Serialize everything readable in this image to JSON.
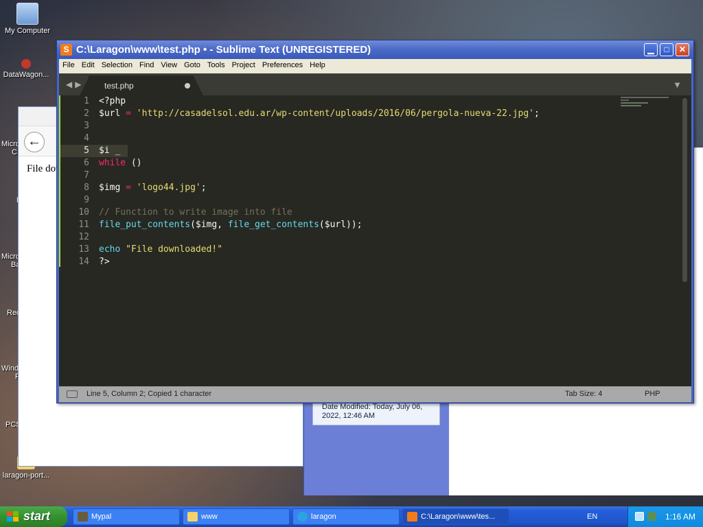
{
  "desktop": {
    "icons": [
      {
        "label": "My Computer"
      },
      {
        "label": "DataWagon..."
      },
      {
        "label": "laragon-port..."
      }
    ],
    "partial_labels": [
      "Micro",
      "C",
      "N",
      "Micro",
      "Ba",
      "Rec",
      "Windo",
      "F",
      "PCS"
    ]
  },
  "bg_browser": {
    "content_text": "File dov"
  },
  "bg_explorer": {
    "details_text": "Date Modified: Today, July 06, 2022, 12:46 AM"
  },
  "sublime": {
    "title": "C:\\Laragon\\www\\test.php • - Sublime Text (UNREGISTERED)",
    "menu": [
      "File",
      "Edit",
      "Selection",
      "Find",
      "View",
      "Goto",
      "Tools",
      "Project",
      "Preferences",
      "Help"
    ],
    "tab": {
      "label": "test.php"
    },
    "active_line": 5,
    "code_lines": [
      {
        "n": "1",
        "tokens": [
          {
            "t": "<?php",
            "c": ""
          }
        ]
      },
      {
        "n": "2",
        "tokens": [
          {
            "t": "$url",
            "c": ""
          },
          {
            "t": " = ",
            "c": "op"
          },
          {
            "t": "'http://casadelsol.edu.ar/wp-content/uploads/2016/06/pergola-nueva-22.jpg'",
            "c": "str"
          },
          {
            "t": ";",
            "c": ""
          }
        ]
      },
      {
        "n": "3",
        "tokens": []
      },
      {
        "n": "4",
        "tokens": []
      },
      {
        "n": "5",
        "tokens": [
          {
            "t": "$i _",
            "c": ""
          }
        ]
      },
      {
        "n": "6",
        "tokens": [
          {
            "t": "while",
            "c": "kw"
          },
          {
            "t": " ()",
            "c": ""
          }
        ]
      },
      {
        "n": "7",
        "tokens": []
      },
      {
        "n": "8",
        "tokens": [
          {
            "t": "$img",
            "c": ""
          },
          {
            "t": " = ",
            "c": "op"
          },
          {
            "t": "'logo44.jpg'",
            "c": "str"
          },
          {
            "t": ";",
            "c": ""
          }
        ]
      },
      {
        "n": "9",
        "tokens": []
      },
      {
        "n": "10",
        "tokens": [
          {
            "t": "// Function to write image into file",
            "c": "cm"
          }
        ]
      },
      {
        "n": "11",
        "tokens": [
          {
            "t": "file_put_contents",
            "c": "fn"
          },
          {
            "t": "($img, ",
            "c": ""
          },
          {
            "t": "file_get_contents",
            "c": "fn"
          },
          {
            "t": "($url));",
            "c": ""
          }
        ]
      },
      {
        "n": "12",
        "tokens": []
      },
      {
        "n": "13",
        "tokens": [
          {
            "t": "echo",
            "c": "fn"
          },
          {
            "t": " ",
            "c": ""
          },
          {
            "t": "\"File downloaded!\"",
            "c": "str"
          }
        ]
      },
      {
        "n": "14",
        "tokens": [
          {
            "t": "?>",
            "c": ""
          }
        ]
      }
    ],
    "status": {
      "text": "Line 5, Column 2; Copied 1 character",
      "tab_size": "Tab Size: 4",
      "syntax": "PHP"
    },
    "colors": {
      "background": "#272822",
      "string": "#e6db74",
      "keyword": "#f92672",
      "function": "#66d9ef",
      "comment": "#75715e"
    }
  },
  "taskbar": {
    "start_label": "start",
    "tasks": [
      {
        "label": "Mypal",
        "icon": "mypal-icon"
      },
      {
        "label": "www",
        "icon": "folder-icon"
      },
      {
        "label": "laragon",
        "icon": "laragon-icon"
      },
      {
        "label": "C:\\Laragon\\www\\tes...",
        "icon": "sublime-icon"
      }
    ],
    "language": "EN",
    "clock": "1:16 AM"
  }
}
